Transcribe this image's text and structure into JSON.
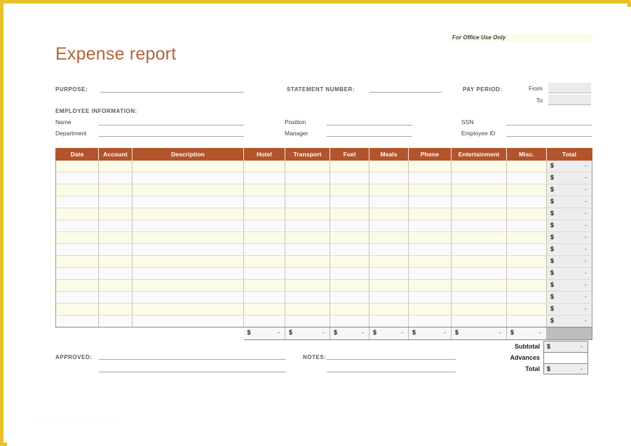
{
  "document": {
    "title": "Expense report",
    "office_use_note": "For Office Use Only",
    "watermark": "www.templatelab.com"
  },
  "header_fields": {
    "purpose_label": "PURPOSE:",
    "statement_number_label": "STATEMENT NUMBER:",
    "pay_period_label": "PAY PERIOD:",
    "pay_period_from_label": "From",
    "pay_period_to_label": "To",
    "purpose_value": "",
    "statement_number_value": "",
    "pay_period_from_value": "",
    "pay_period_to_value": ""
  },
  "employee_information": {
    "section_label": "EMPLOYEE INFORMATION:",
    "fields": [
      {
        "label": "Name",
        "value": ""
      },
      {
        "label": "Department",
        "value": ""
      },
      {
        "label": "Position",
        "value": ""
      },
      {
        "label": "Manager",
        "value": ""
      },
      {
        "label": "SSN",
        "value": ""
      },
      {
        "label": "Employee ID",
        "value": ""
      }
    ]
  },
  "expense_table": {
    "columns": [
      "Date",
      "Account",
      "Description",
      "Hotel",
      "Transport",
      "Fuel",
      "Meals",
      "Phone",
      "Entertainment",
      "Misc.",
      "Total"
    ],
    "row_count": 14,
    "empty_cell": "",
    "currency_symbol": "$",
    "zero_placeholder": "-",
    "row_total_currency": "$",
    "row_total_value": "-",
    "column_totals": [
      {
        "column": "Hotel",
        "currency": "$",
        "value": "-"
      },
      {
        "column": "Transport",
        "currency": "$",
        "value": "-"
      },
      {
        "column": "Fuel",
        "currency": "$",
        "value": "-"
      },
      {
        "column": "Meals",
        "currency": "$",
        "value": "-"
      },
      {
        "column": "Phone",
        "currency": "$",
        "value": "-"
      },
      {
        "column": "Entertainment",
        "currency": "$",
        "value": "-"
      },
      {
        "column": "Misc.",
        "currency": "$",
        "value": "-"
      }
    ]
  },
  "summary": {
    "rows": [
      {
        "label": "Subtotal",
        "currency": "$",
        "value": "-",
        "filled": true
      },
      {
        "label": "Advances",
        "currency": "",
        "value": "",
        "filled": false
      },
      {
        "label": "Total",
        "currency": "$",
        "value": "-",
        "filled": true
      }
    ]
  },
  "footer": {
    "approved_label": "APPROVED:",
    "approved_value": "",
    "notes_label": "NOTES:",
    "notes_value": ""
  },
  "colors": {
    "frame": "#e8c12b",
    "title": "#b4633a",
    "table_header": "#b3542a",
    "row_stripe": "#fbfbe8",
    "money_cell": "#ededed",
    "gray_total_cell": "#bdbdbd"
  }
}
